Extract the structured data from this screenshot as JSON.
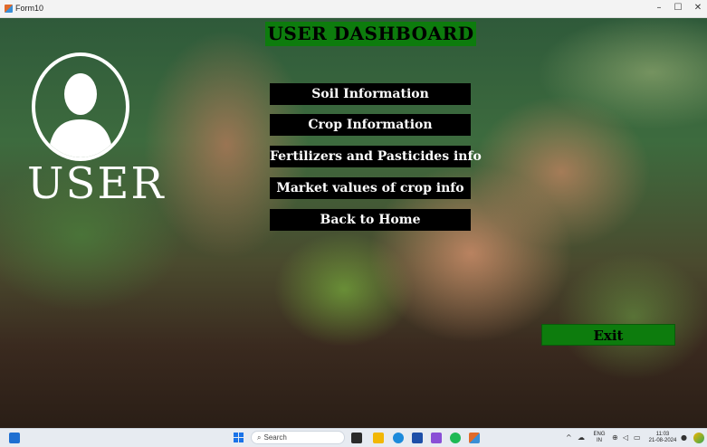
{
  "window": {
    "title": "Form10",
    "minimize_glyph": "–",
    "maximize_glyph": "☐",
    "close_glyph": "✕"
  },
  "sidebar": {
    "user_label": "USER",
    "avatar_icon": "user-silhouette-icon"
  },
  "header": {
    "title": "USER DASHBOARD"
  },
  "menu": {
    "items": [
      {
        "label": "Soil Information"
      },
      {
        "label": "Crop Information"
      },
      {
        "label": "Fertilizers and Pasticides info"
      },
      {
        "label": "Market values of crop info"
      },
      {
        "label": "Back to Home"
      }
    ]
  },
  "exit": {
    "label": "Exit"
  },
  "taskbar": {
    "search_placeholder": "Search",
    "search_icon": "magnifier-icon",
    "language_top": "ENG",
    "language_bottom": "IN",
    "time": "11:03",
    "date": "21-08-2024"
  },
  "colors": {
    "accent_green": "#0d7c0d",
    "button_black": "#000000",
    "text_white": "#ffffff"
  }
}
